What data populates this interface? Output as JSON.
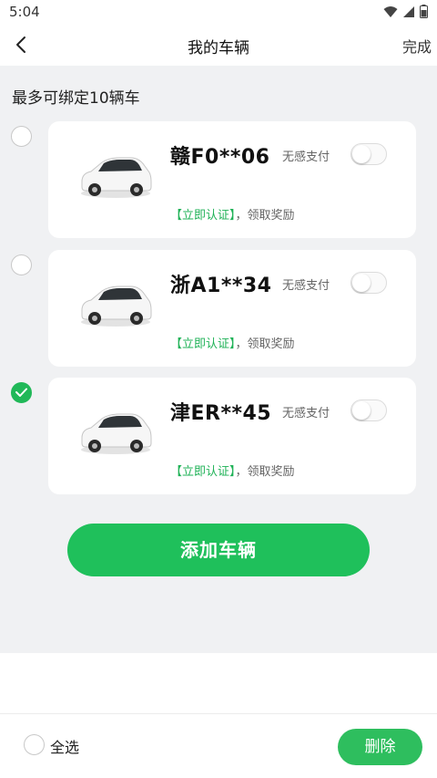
{
  "status_bar": {
    "time": "5:04"
  },
  "nav": {
    "title": "我的车辆",
    "done_label": "完成"
  },
  "hint": "最多可绑定10辆车",
  "vehicles": [
    {
      "plate": "赣F0**06",
      "pay_label": "无感支付",
      "pay_enabled": false,
      "verify_text": "【立即认证】",
      "reward_text": "，领取奖励",
      "selected": false
    },
    {
      "plate": "浙A1**34",
      "pay_label": "无感支付",
      "pay_enabled": false,
      "verify_text": "【立即认证】",
      "reward_text": "，领取奖励",
      "selected": false
    },
    {
      "plate": "津ER**45",
      "pay_label": "无感支付",
      "pay_enabled": false,
      "verify_text": "【立即认证】",
      "reward_text": "，领取奖励",
      "selected": true
    }
  ],
  "add_button_label": "添加车辆",
  "bottom": {
    "select_all_label": "全选",
    "delete_label": "删除"
  },
  "colors": {
    "accent": "#1fc05b",
    "verify_text": "#1fb257",
    "content_bg": "#f0f1f3"
  },
  "icons": {
    "back": "chevron-left-icon",
    "wifi": "wifi-icon",
    "signal": "signal-icon",
    "battery": "battery-icon",
    "car": "car-icon",
    "check": "check-icon"
  }
}
